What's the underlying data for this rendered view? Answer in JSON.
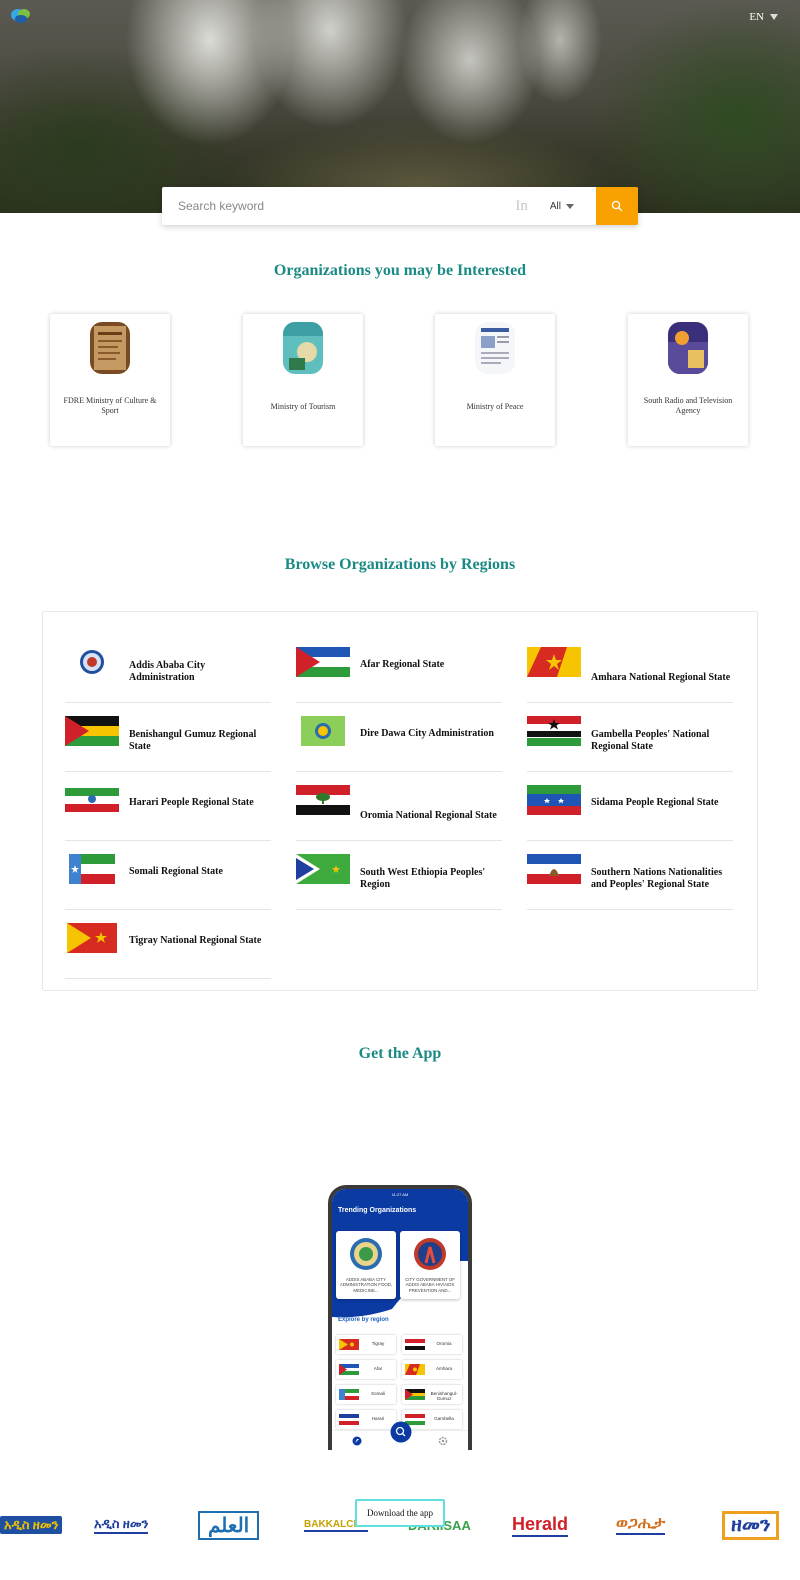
{
  "header": {
    "language": "EN"
  },
  "search": {
    "placeholder": "Search keyword",
    "in_label": "In",
    "scope_selected": "All"
  },
  "interested": {
    "title": "Organizations you may be Interested",
    "cards": [
      {
        "name": "FDRE Ministry of Culture & Sport"
      },
      {
        "name": "Ministry of Tourism"
      },
      {
        "name": "Ministry of Peace"
      },
      {
        "name": "South Radio and Television Agency"
      }
    ]
  },
  "regions": {
    "title": "Browse Organizations by Regions",
    "items": [
      {
        "name": "Addis Ababa City Administration"
      },
      {
        "name": "Afar Regional State"
      },
      {
        "name": "Amhara National Regional State"
      },
      {
        "name": "Benishangul Gumuz Regional State"
      },
      {
        "name": "Dire Dawa City Administration"
      },
      {
        "name": "Gambella Peoples' National Regional State"
      },
      {
        "name": "Harari People Regional State"
      },
      {
        "name": "Oromia National Regional State"
      },
      {
        "name": "Sidama People Regional State"
      },
      {
        "name": "Somali Regional State"
      },
      {
        "name": "South West Ethiopia Peoples' Region"
      },
      {
        "name": "Southern Nations Nationalities and Peoples' Regional State"
      },
      {
        "name": "Tigray National Regional State"
      }
    ]
  },
  "app": {
    "title": "Get the App",
    "download_label": "Download the app",
    "phone": {
      "status_time": "11:27 AM",
      "trending_title": "Trending Organizations",
      "card1": "ADDIS ABABA CITY ADMINISTRATION FOOD, MEDICINE...",
      "card2": "CITY GOVERNMENT OF ADDIS ABABA HIV/AIDS PREVENTION AND...",
      "explore_title": "Explore by region",
      "items": [
        "Tigray",
        "Oromia",
        "Afar",
        "Amhara",
        "Somali",
        "Benishangul-Gumuz",
        "Harari",
        "Gambella"
      ]
    }
  },
  "media_logos": [
    {
      "text": "አዲስ ዘመን"
    },
    {
      "text": "አዲስ ዘመን"
    },
    {
      "text": "العلم"
    },
    {
      "text": "BAKKALCHO"
    },
    {
      "text": "DARIISAA"
    },
    {
      "text": "Herald"
    },
    {
      "text": "ወጋሒታ"
    },
    {
      "text": "ዘመን"
    }
  ],
  "colors": {
    "accent": "#1b8a84",
    "search_button": "#f8a100",
    "download_border": "#5fe0df"
  }
}
